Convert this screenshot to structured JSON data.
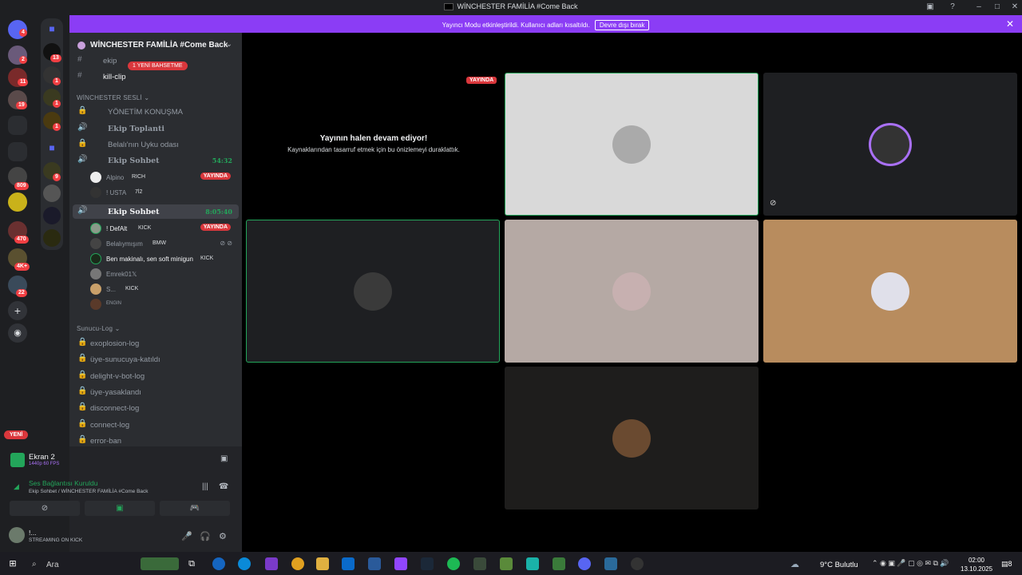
{
  "window": {
    "title": "WİNCHESTER FAMİLİA #Come Back"
  },
  "banner": {
    "text": "Yayıncı Modu etkinleştirildi. Kullanıcı adları kısaltıldı.",
    "button": "Devre dışı bırak"
  },
  "server_badges": [
    "4",
    "2",
    "11",
    "19",
    "809",
    "470",
    "4K+",
    "22"
  ],
  "folder_badges": [
    "13",
    "1",
    "1",
    "1",
    "9"
  ],
  "server": {
    "name": "WİNCHESTER FAMİLİA #Come Back"
  },
  "channels_top": [
    {
      "name": "ekip"
    },
    {
      "name": "kill-clip"
    }
  ],
  "mention": "1 YENİ BAHSETME",
  "voice_category": "WİNCHESTER SESLİ",
  "voice_channels": [
    {
      "name": "YÖNETİM KONUŞMA"
    },
    {
      "name": "Ekip Toplanti"
    },
    {
      "name": "Belalı'nın Uyku odası"
    },
    {
      "name": "Ekip Sohbet",
      "timer": "54:32"
    },
    {
      "name": "Ekip Sohbet",
      "timer": "8:05:40"
    }
  ],
  "users_a": [
    {
      "name": "Alpino",
      "tag": "RICH",
      "live": "YAYINDA"
    },
    {
      "name": "! USTA",
      "tag": "7l2",
      "live": ""
    }
  ],
  "users_b": [
    {
      "name": "! DefAlt",
      "tag": "KICK",
      "live": "YAYINDA"
    },
    {
      "name": "Belalıymışım",
      "tag": "BMW",
      "live": ""
    },
    {
      "name": "Ben makinalı, sen soft minigun",
      "tag": "KICK",
      "live": ""
    },
    {
      "name": "Emrek01𝕏",
      "tag": "",
      "live": ""
    },
    {
      "name": "S...",
      "tag": "KICK",
      "live": ""
    },
    {
      "name": "",
      "tag": "ENGIN",
      "live": ""
    }
  ],
  "log_category": "Sunucu-Log",
  "log_channels": [
    "exoplosion-log",
    "üye-sunucuya-katıldı",
    "delight-v-bot-log",
    "üye-yasaklandı",
    "disconnect-log",
    "connect-log",
    "error-ban"
  ],
  "new_pill": "YENİ",
  "stream": {
    "title": "Ekran 2",
    "sub": "1440p 60 FPS"
  },
  "connection": {
    "status": "Ses Bağlantısı Kuruldu",
    "detail": "Ekip Sohbet / WİNCHESTER FAMİLİA #Come Back"
  },
  "me": {
    "name": "!...",
    "status": "STREAMING ON KICK"
  },
  "stage": {
    "live_badge": "YAYINDA",
    "msg_title": "Yayının halen devam ediyor!",
    "msg_sub": "Kaynaklarından tasarruf etmek için bu önizlemeyi duraklattık."
  },
  "taskbar": {
    "search": "Ara",
    "weather": "9°C  Bulutlu",
    "time": "02:00",
    "date": "13.10.2025",
    "notif": "8"
  }
}
